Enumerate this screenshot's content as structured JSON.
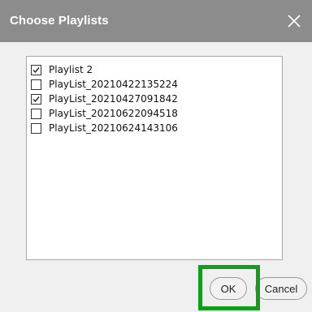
{
  "dialog": {
    "title": "Choose Playlists",
    "close_icon": "close-icon"
  },
  "playlists": [
    {
      "label": "Playlist 2",
      "checked": true
    },
    {
      "label": "PlayList_20210422135224",
      "checked": false
    },
    {
      "label": "PlayList_20210427091842",
      "checked": true
    },
    {
      "label": "PlayList_20210622094518",
      "checked": false
    },
    {
      "label": "PlayList_20210624143106",
      "checked": false
    }
  ],
  "buttons": {
    "ok_label": "OK",
    "cancel_label": "Cancel"
  },
  "colors": {
    "titlebar": "#8c8c8c",
    "highlight": "#169c1d"
  }
}
